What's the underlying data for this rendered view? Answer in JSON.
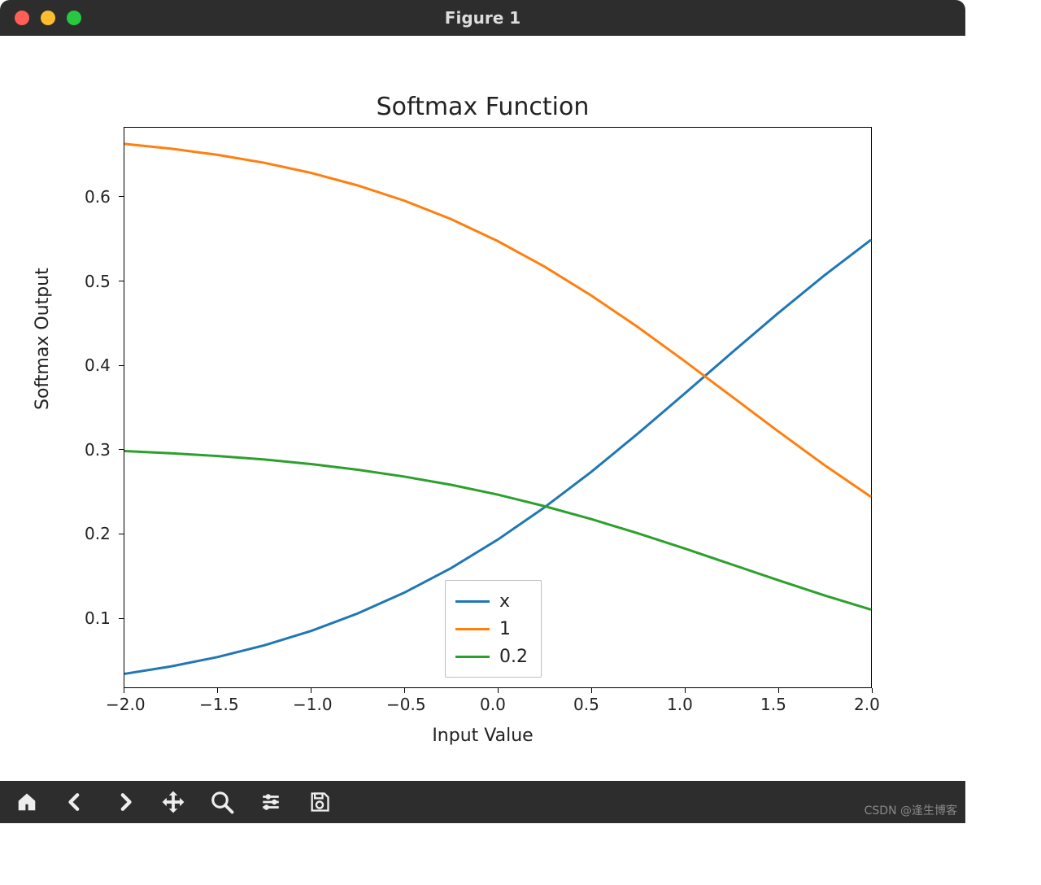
{
  "window": {
    "title": "Figure 1"
  },
  "toolbar": {
    "home": "Home",
    "back": "Back",
    "forward": "Forward",
    "pan": "Pan",
    "zoom": "Zoom",
    "configure": "Configure subplots",
    "save": "Save"
  },
  "credit": "CSDN @逢生博客",
  "chart_data": {
    "type": "line",
    "title": "Softmax Function",
    "xlabel": "Input Value",
    "ylabel": "Softmax Output",
    "xlim": [
      -2.0,
      2.0
    ],
    "ylim": [
      0.017,
      0.683
    ],
    "xticks": [
      "−2.0",
      "−1.5",
      "−1.0",
      "−0.5",
      "0.0",
      "0.5",
      "1.0",
      "1.5",
      "2.0"
    ],
    "yticks": [
      "0.1",
      "0.2",
      "0.3",
      "0.4",
      "0.5",
      "0.6"
    ],
    "legend": [
      "x",
      "1",
      "0.2"
    ],
    "colors": {
      "x": "#1f77b4",
      "1": "#ff7f0e",
      "0.2": "#2ca02c"
    },
    "x": [
      -2.0,
      -1.75,
      -1.5,
      -1.25,
      -1.0,
      -0.75,
      -0.5,
      -0.25,
      0.0,
      0.25,
      0.5,
      0.75,
      1.0,
      1.25,
      1.5,
      1.75,
      2.0
    ],
    "series": [
      {
        "name": "x",
        "values": [
          0.033,
          0.0419,
          0.0531,
          0.067,
          0.0841,
          0.1049,
          0.1297,
          0.1589,
          0.1928,
          0.2311,
          0.2733,
          0.3188,
          0.3663,
          0.4145,
          0.4619,
          0.5072,
          0.5496
        ]
      },
      {
        "name": "1",
        "values": [
          0.6638,
          0.6581,
          0.6507,
          0.6412,
          0.6292,
          0.6143,
          0.5961,
          0.5742,
          0.5481,
          0.5178,
          0.4835,
          0.4458,
          0.4055,
          0.3638,
          0.3221,
          0.2816,
          0.2436
        ]
      },
      {
        "name": "0.2",
        "values": [
          0.2982,
          0.2956,
          0.2923,
          0.2881,
          0.2827,
          0.276,
          0.2678,
          0.258,
          0.2463,
          0.2326,
          0.2173,
          0.2004,
          0.1823,
          0.1635,
          0.1447,
          0.1265,
          0.1095
        ]
      }
    ]
  }
}
